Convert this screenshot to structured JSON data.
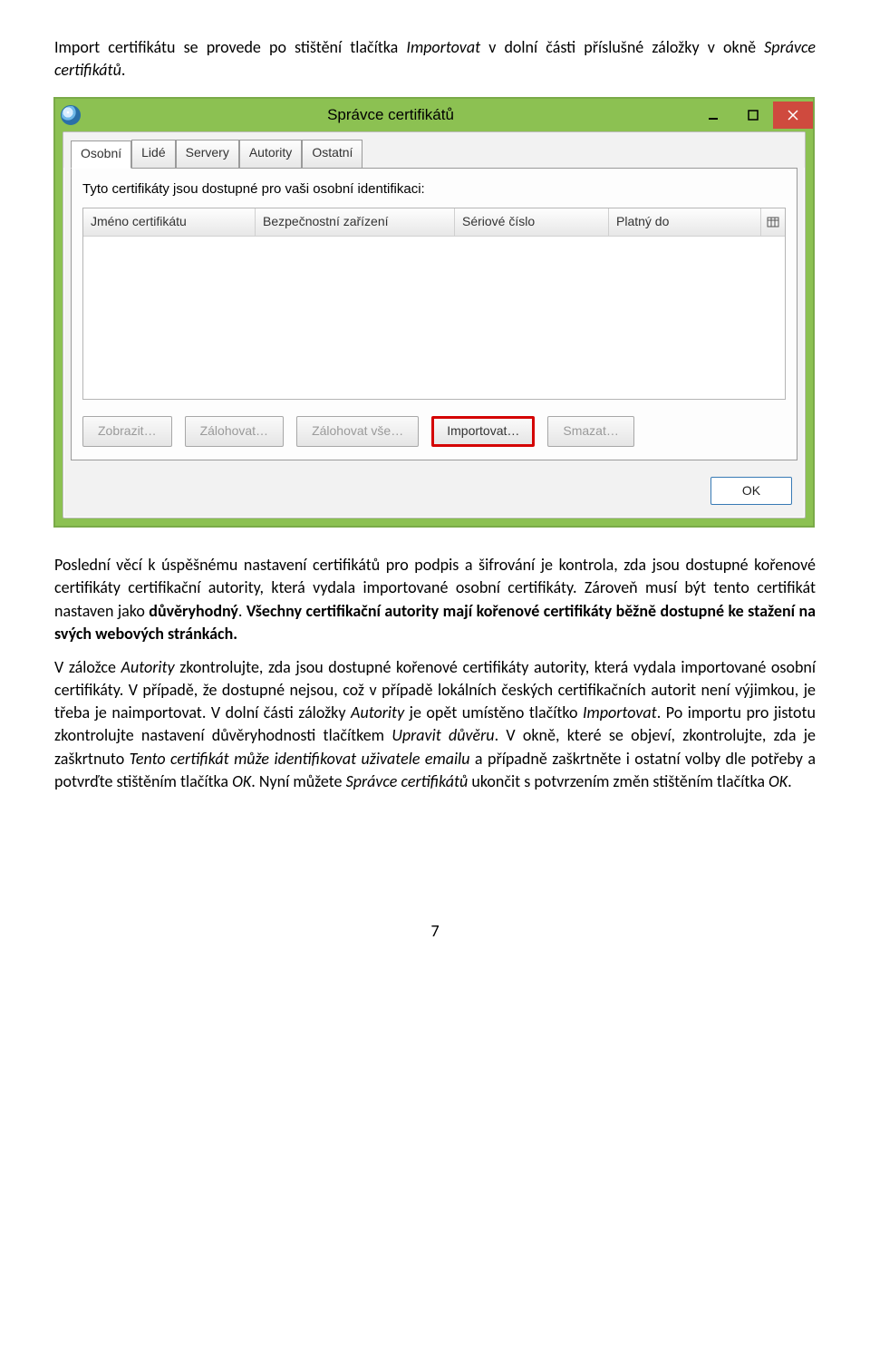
{
  "intro": {
    "part1": "Import certifikátu se provede po stištění tlačítka ",
    "import_word": "Importovat",
    "part2": " v dolní části příslušné záložky v okně ",
    "manager_word": "Správce certifikátů",
    "part3": "."
  },
  "window": {
    "title": "Správce certifikátů",
    "tabs": [
      "Osobní",
      "Lidé",
      "Servery",
      "Autority",
      "Ostatní"
    ],
    "active_tab_index": 0,
    "panel_desc": "Tyto certifikáty jsou dostupné pro vaši osobní identifikaci:",
    "columns": [
      "Jméno certifikátu",
      "Bezpečnostní zařízení",
      "Sériové číslo",
      "Platný do"
    ],
    "buttons": {
      "view": "Zobrazit…",
      "backup": "Zálohovat…",
      "backup_all": "Zálohovat vše…",
      "import": "Importovat…",
      "delete": "Smazat…"
    },
    "ok": "OK"
  },
  "para2": {
    "p1": "Poslední věcí k úspěšnému nastavení certifikátů pro podpis a šifrování je kontrola, zda jsou dostupné kořenové certifikáty certifikační autority, která vydala importované osobní certifikáty. Zároveň musí být tento certifikát nastaven jako ",
    "bold1": "důvěryhodný",
    "p2": ". ",
    "bold2": "Všechny certifikační autority mají kořenové certifikáty běžně dostupné ke stažení na svých webových stránkách."
  },
  "para3": {
    "p1": "V záložce ",
    "i1": "Autority",
    "p2": " zkontrolujte, zda jsou dostupné kořenové certifikáty autority, která vydala importované osobní certifikáty. V případě, že dostupné nejsou, což v případě lokálních českých certifikačních autorit není výjimkou, je třeba je naimportovat. V dolní části záložky ",
    "i2": "Autority",
    "p3": " je opět umístěno tlačítko ",
    "i3": "Importovat",
    "p4": ". Po importu pro jistotu zkontrolujte nastavení důvěryhodnosti tlačítkem ",
    "i4": "Upravit důvěru",
    "p5": ". V okně, které se objeví, zkontrolujte, zda je zaškrtnuto ",
    "i5": "Tento certifikát může identifikovat uživatele emailu",
    "p6": " a případně zaškrtněte i ostatní volby dle potřeby a potvrďte stištěním tlačítka ",
    "i6": "OK",
    "p7": ". Nyní můžete ",
    "i7": "Správce certifikátů",
    "p8": " ukončit s potvrzením změn stištěním tlačítka ",
    "i8": "OK",
    "p9": "."
  },
  "page_number": "7"
}
